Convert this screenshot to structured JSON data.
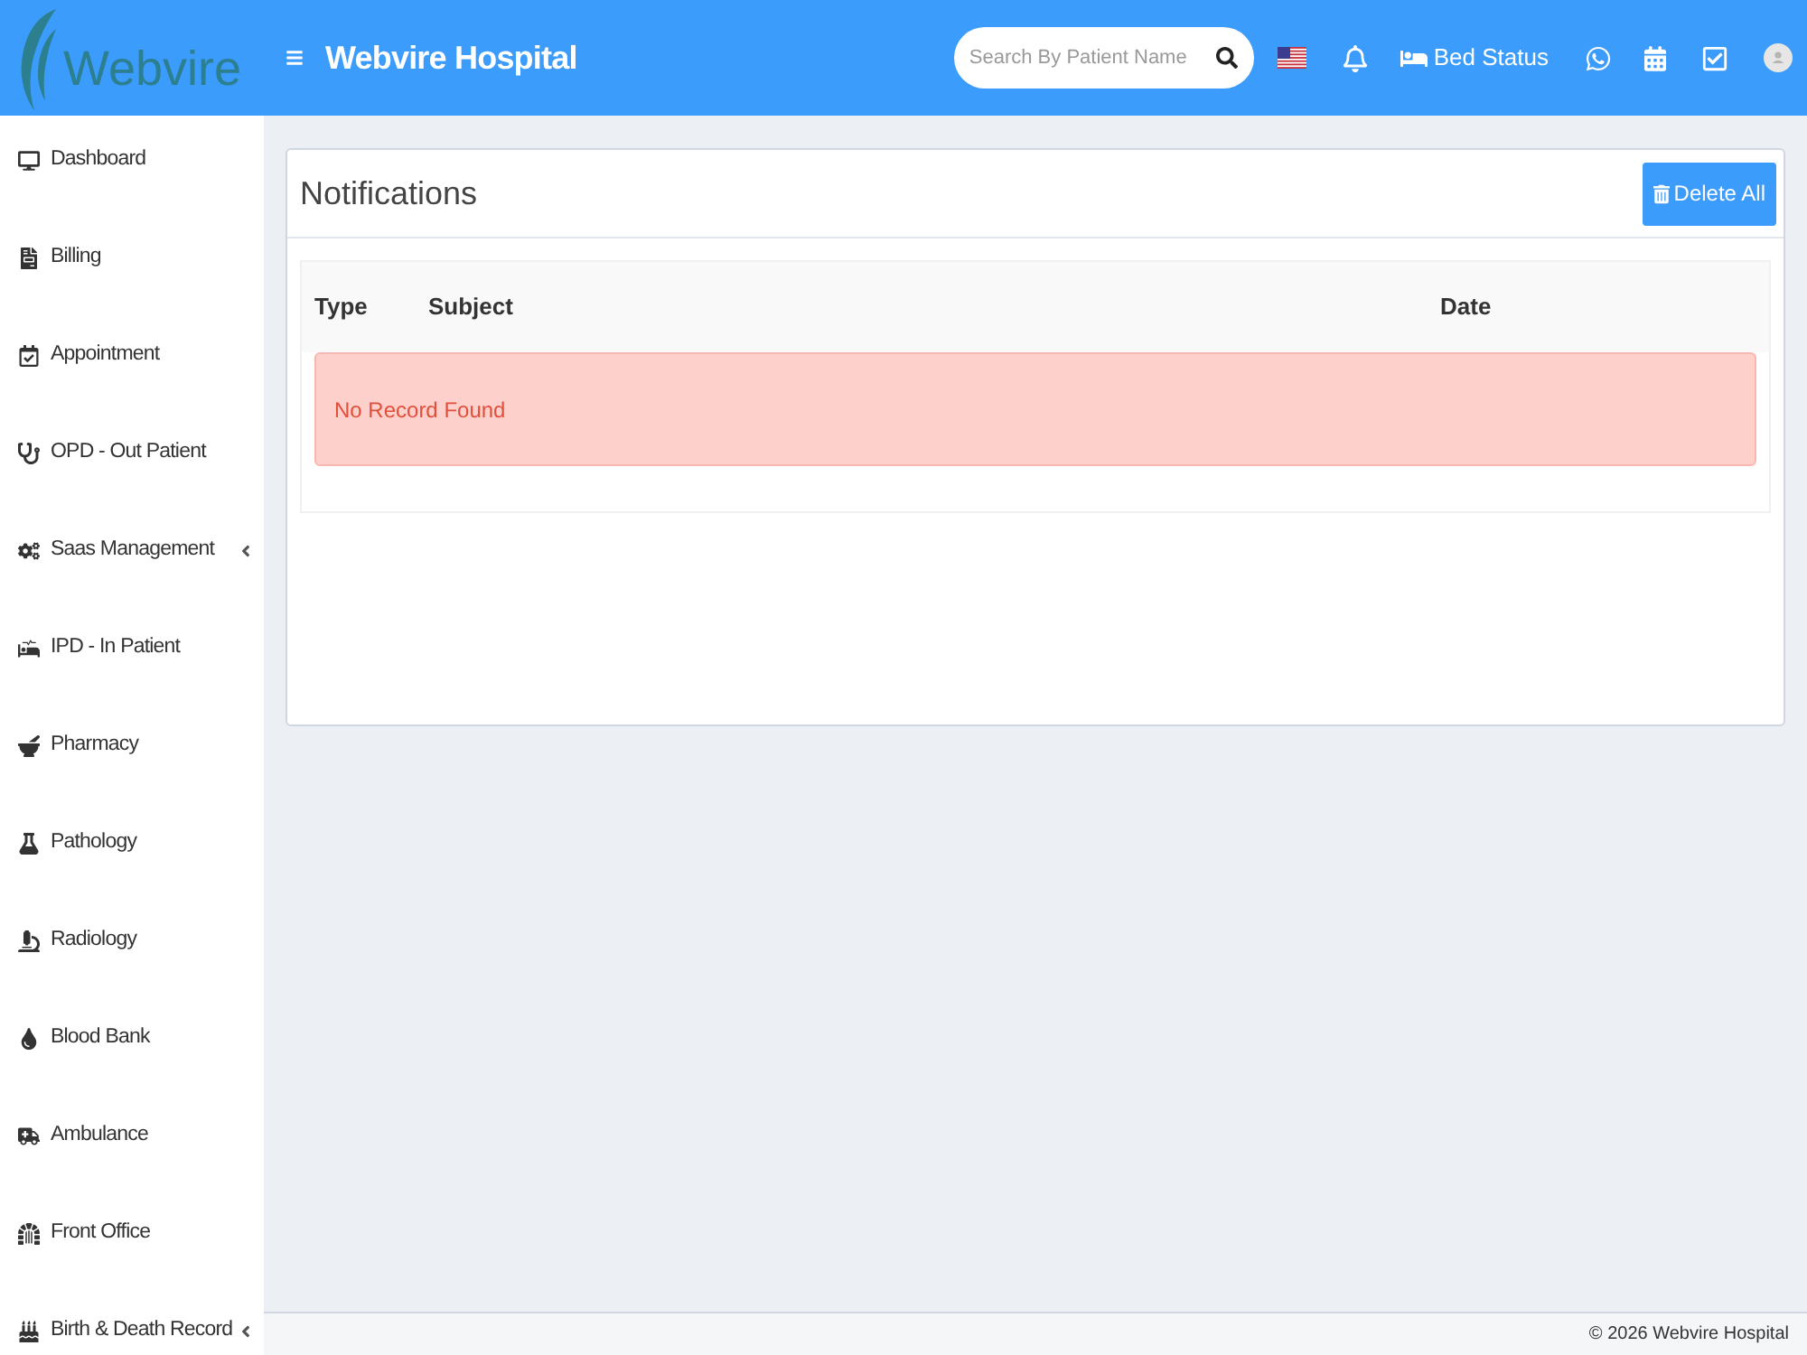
{
  "header": {
    "logo_text": "Webvire",
    "title": "Webvire Hospital",
    "search": {
      "placeholder": "Search By Patient Name"
    },
    "bed_status": "Bed Status"
  },
  "sidebar": {
    "items": [
      {
        "label": "Dashboard",
        "has_submenu": false
      },
      {
        "label": "Billing",
        "has_submenu": false
      },
      {
        "label": "Appointment",
        "has_submenu": false
      },
      {
        "label": "OPD - Out Patient",
        "has_submenu": false
      },
      {
        "label": "Saas Management",
        "has_submenu": true
      },
      {
        "label": "IPD - In Patient",
        "has_submenu": false
      },
      {
        "label": "Pharmacy",
        "has_submenu": false
      },
      {
        "label": "Pathology",
        "has_submenu": false
      },
      {
        "label": "Radiology",
        "has_submenu": false
      },
      {
        "label": "Blood Bank",
        "has_submenu": false
      },
      {
        "label": "Ambulance",
        "has_submenu": false
      },
      {
        "label": "Front Office",
        "has_submenu": false
      },
      {
        "label": "Birth & Death Record",
        "has_submenu": true
      }
    ]
  },
  "notifications": {
    "title": "Notifications",
    "delete_button": "Delete All",
    "table": {
      "columns": [
        "Type",
        "Subject",
        "Date"
      ],
      "empty_message": "No Record Found"
    }
  },
  "footer": {
    "copyright": "© 2026 Webvire Hospital"
  }
}
